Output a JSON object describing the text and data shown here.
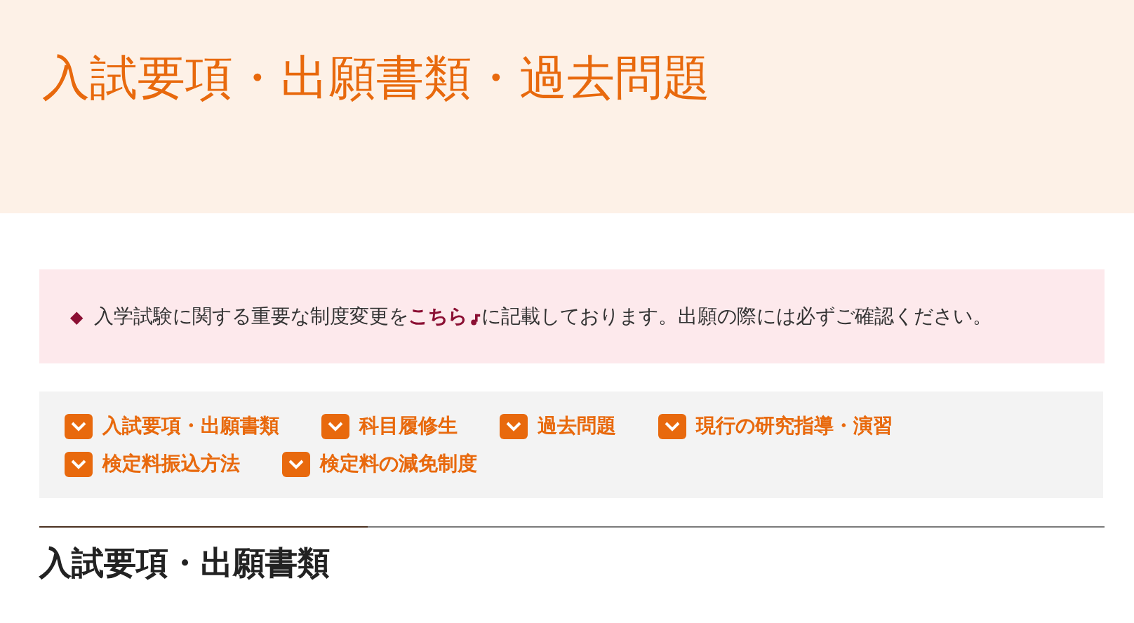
{
  "page_title": "入試要項・出願書類・過去問題",
  "notice": {
    "marker": "◆",
    "before": "入学試験に関する重要な制度変更を",
    "link": "こちら",
    "after": "に記載しております。出願の際には必ずご確認ください。"
  },
  "anchor_links": [
    {
      "label": "入試要項・出願書類"
    },
    {
      "label": "科目履修生"
    },
    {
      "label": "過去問題"
    },
    {
      "label": "現行の研究指導・演習"
    },
    {
      "label": "検定料振込方法"
    },
    {
      "label": "検定料の減免制度"
    }
  ],
  "section_heading": "入試要項・出願書類"
}
